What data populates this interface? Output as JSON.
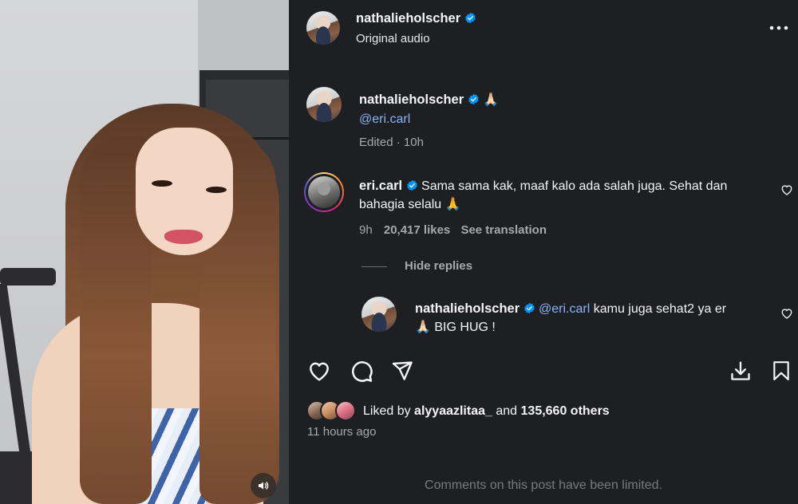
{
  "post": {
    "author": "nathalieholscher",
    "audio": "Original audio",
    "more_icon": "more-horizontal-icon"
  },
  "caption": {
    "author": "nathalieholscher",
    "emoji": "🙏🏻",
    "mention": "@eri.carl",
    "edited": "Edited",
    "edited_sep": "·",
    "time": "10h"
  },
  "comment": {
    "author": "eri.carl",
    "text_line1": "Sama sama kak, maaf kalo ada salah juga. Sehat dan",
    "text_line2": "bahagia selalu",
    "emoji": "🙏",
    "time": "9h",
    "likes": "20,417 likes",
    "translate": "See translation",
    "hide_replies": "Hide replies"
  },
  "reply": {
    "author": "nathalieholscher",
    "mention": "@eri.carl",
    "text_line1": "kamu juga sehat2 ya er",
    "emoji": "🙏🏻",
    "text_line2": "BIG HUG !"
  },
  "actions": {
    "like_icon": "heart-icon",
    "comment_icon": "comment-icon",
    "share_icon": "send-icon",
    "save_icon": "bookmark-icon",
    "download_icon": "download-icon"
  },
  "likes": {
    "prefix": "Liked by",
    "first_liker": "alyyaazlitaa_",
    "and": "and",
    "others": "135,660 others"
  },
  "timestamp": "11 hours ago",
  "footer": "Comments on this post have been limited.",
  "colors": {
    "panel_bg": "#1e1f22",
    "verified": "#0095f6",
    "mention": "#8ab4f8",
    "muted": "#a8a8a8"
  }
}
